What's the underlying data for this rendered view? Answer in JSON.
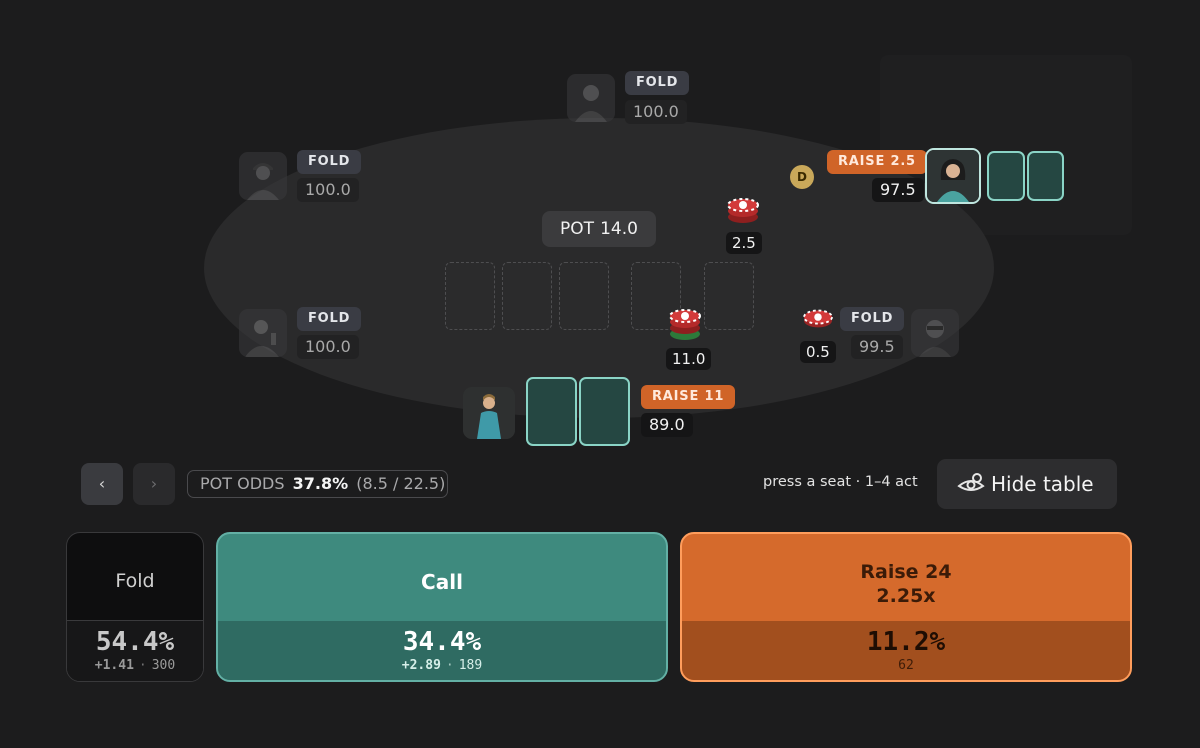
{
  "seats": {
    "top": {
      "action": "FOLD",
      "stack": "100.0"
    },
    "upper_left": {
      "action": "FOLD",
      "stack": "100.0"
    },
    "lower_left": {
      "action": "FOLD",
      "stack": "100.0"
    },
    "hero": {
      "action": "RAISE 11",
      "stack": "89.0",
      "bet": "11.0"
    },
    "lower_right": {
      "action": "FOLD",
      "stack": "99.5",
      "bet": "0.5"
    },
    "upper_right": {
      "action": "RAISE 2.5",
      "stack": "97.5",
      "bet": "2.5"
    }
  },
  "dealer_button": "D",
  "pot": {
    "label": "POT",
    "value": "14.0"
  },
  "controls": {
    "prev_icon": "‹",
    "next_icon": "›",
    "pot_odds_label": "POT ODDS",
    "pot_odds_value": "37.8%",
    "pot_odds_detail": "(8.5 / 22.5)",
    "hint": "press a seat · 1–4 act",
    "hide_table_label": "Hide table",
    "hide_table_icon": "eye-off-icon"
  },
  "actions": {
    "fold": {
      "label": "Fold",
      "pct": "54.4%",
      "ev": "+1.41",
      "count": "300"
    },
    "call": {
      "label": "Call",
      "pct": "34.4%",
      "ev": "+2.89",
      "count": "189"
    },
    "raise": {
      "label": "Raise 24",
      "sizing": "2.25x",
      "pct": "11.2%",
      "count": "62"
    }
  },
  "colors": {
    "background": "#1c1c1d",
    "felt": "#2a2a2b",
    "call": "#3e8a7e",
    "raise": "#d56a2c",
    "card_back": "#254742",
    "card_border": "#8ad4c6"
  }
}
